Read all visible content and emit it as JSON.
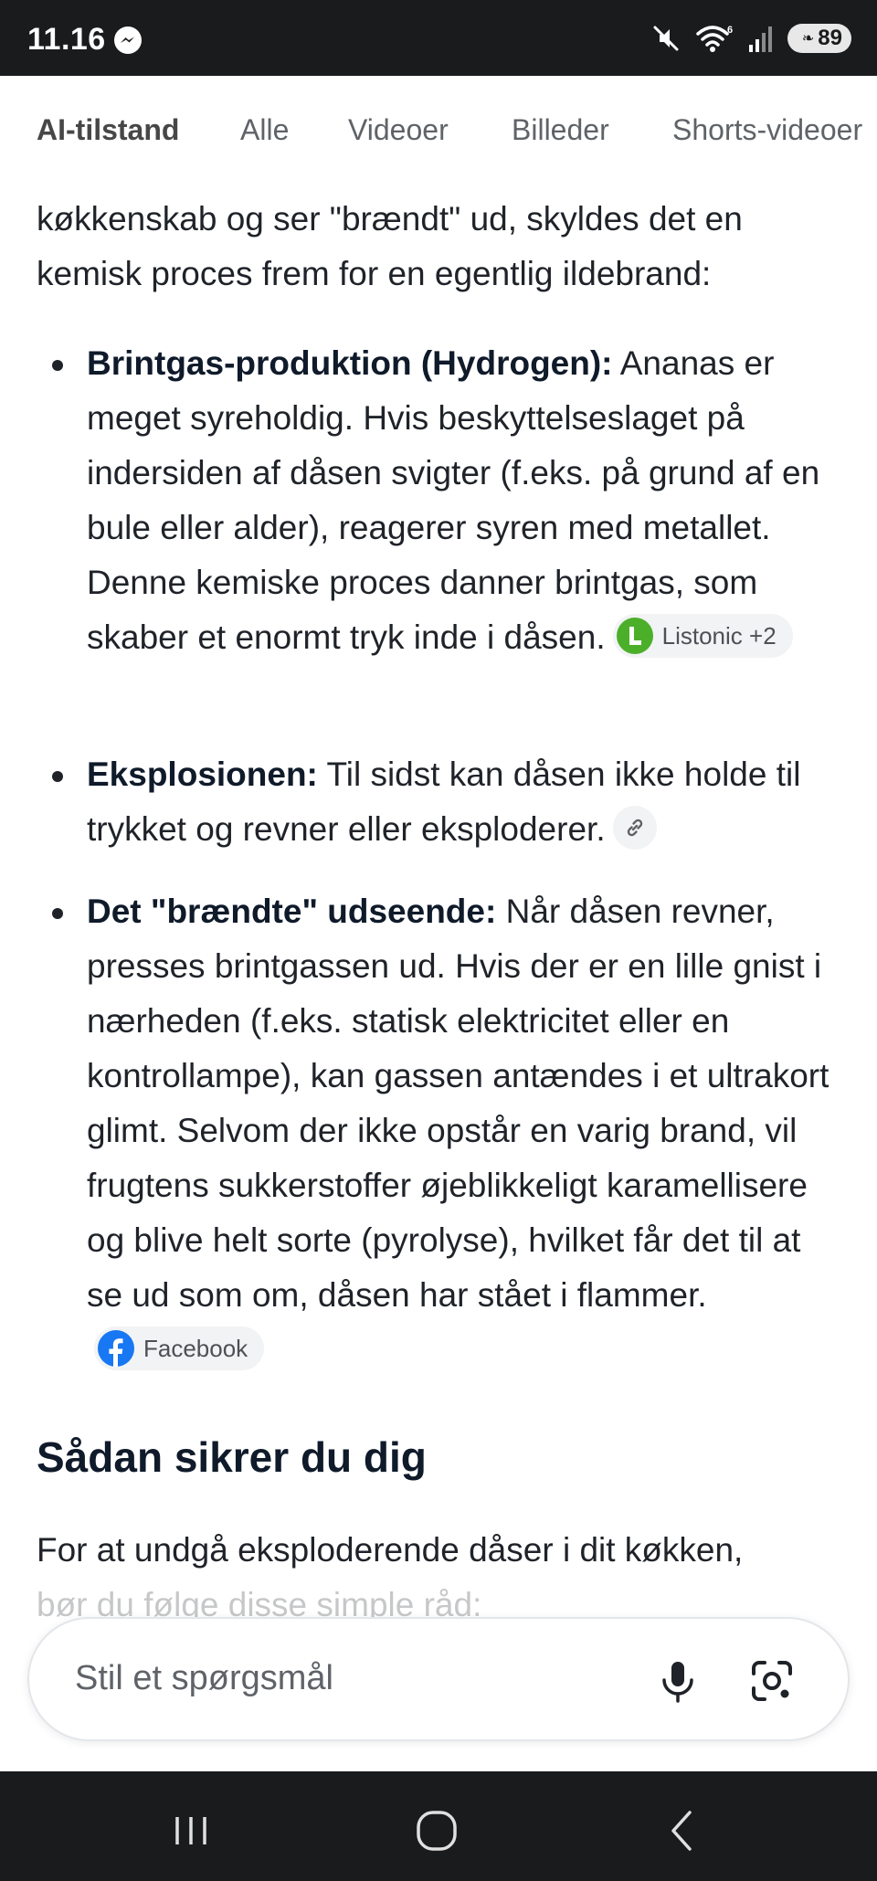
{
  "status_bar": {
    "time": "11.16",
    "battery_level": "89",
    "icons": [
      "messenger-icon",
      "mute-icon",
      "wifi-6-icon",
      "signal-icon",
      "battery-icon"
    ]
  },
  "tabs": [
    {
      "label": "AI-tilstand",
      "active": true
    },
    {
      "label": "Alle",
      "active": false
    },
    {
      "label": "Videoer",
      "active": false
    },
    {
      "label": "Billeder",
      "active": false
    },
    {
      "label": "Shorts-videoer",
      "active": false
    }
  ],
  "content": {
    "intro_line1": "køkkenskab og ser \"brændt\" ud, skyldes det en",
    "intro_line2": "kemisk proces frem for en egentlig ildebrand:",
    "bullets": [
      {
        "title": "Brintgas-produktion (Hydrogen):",
        "text": " Ananas er meget syreholdig. Hvis beskyttelseslaget på indersiden af dåsen svigter (f.eks. på grund af en bule eller alder), reagerer syren med metallet. Denne kemiske proces danner brintgas, som skaber et enormt tryk inde i dåsen.",
        "source_label": "Listonic +2"
      },
      {
        "title": "Eksplosionen:",
        "text": " Til sidst kan dåsen ikke holde til trykket og revner eller eksploderer."
      },
      {
        "title": "Det \"brændte\" udseende:",
        "text": " Når dåsen revner, presses brintgassen ud. Hvis der er en lille gnist i nærheden (f.eks. statisk elektricitet eller en kontrollampe), kan gassen antændes i et ultrakort glimt. Selvom der ikke opstår en varig brand, vil frugtens sukkerstoffer øjeblikkeligt karamellisere og blive helt sorte (pyrolyse), hvilket får det til at se ud som om, dåsen har stået i flammer.",
        "source_label": "Facebook"
      }
    ],
    "heading": "Sådan sikrer du dig",
    "outro_line1": "For at undgå eksploderende dåser i dit køkken,",
    "outro_line2": "bør du følge disse simple råd:"
  },
  "ask_bar": {
    "placeholder": "Stil et spørgsmål"
  },
  "colors": {
    "status_bar_bg": "#1a1b1d",
    "text": "#1f2329",
    "heading": "#0f1a2a",
    "chip_bg": "#f1f3f4",
    "listonic_green": "#4caf2a",
    "facebook_blue": "#1877f2"
  }
}
